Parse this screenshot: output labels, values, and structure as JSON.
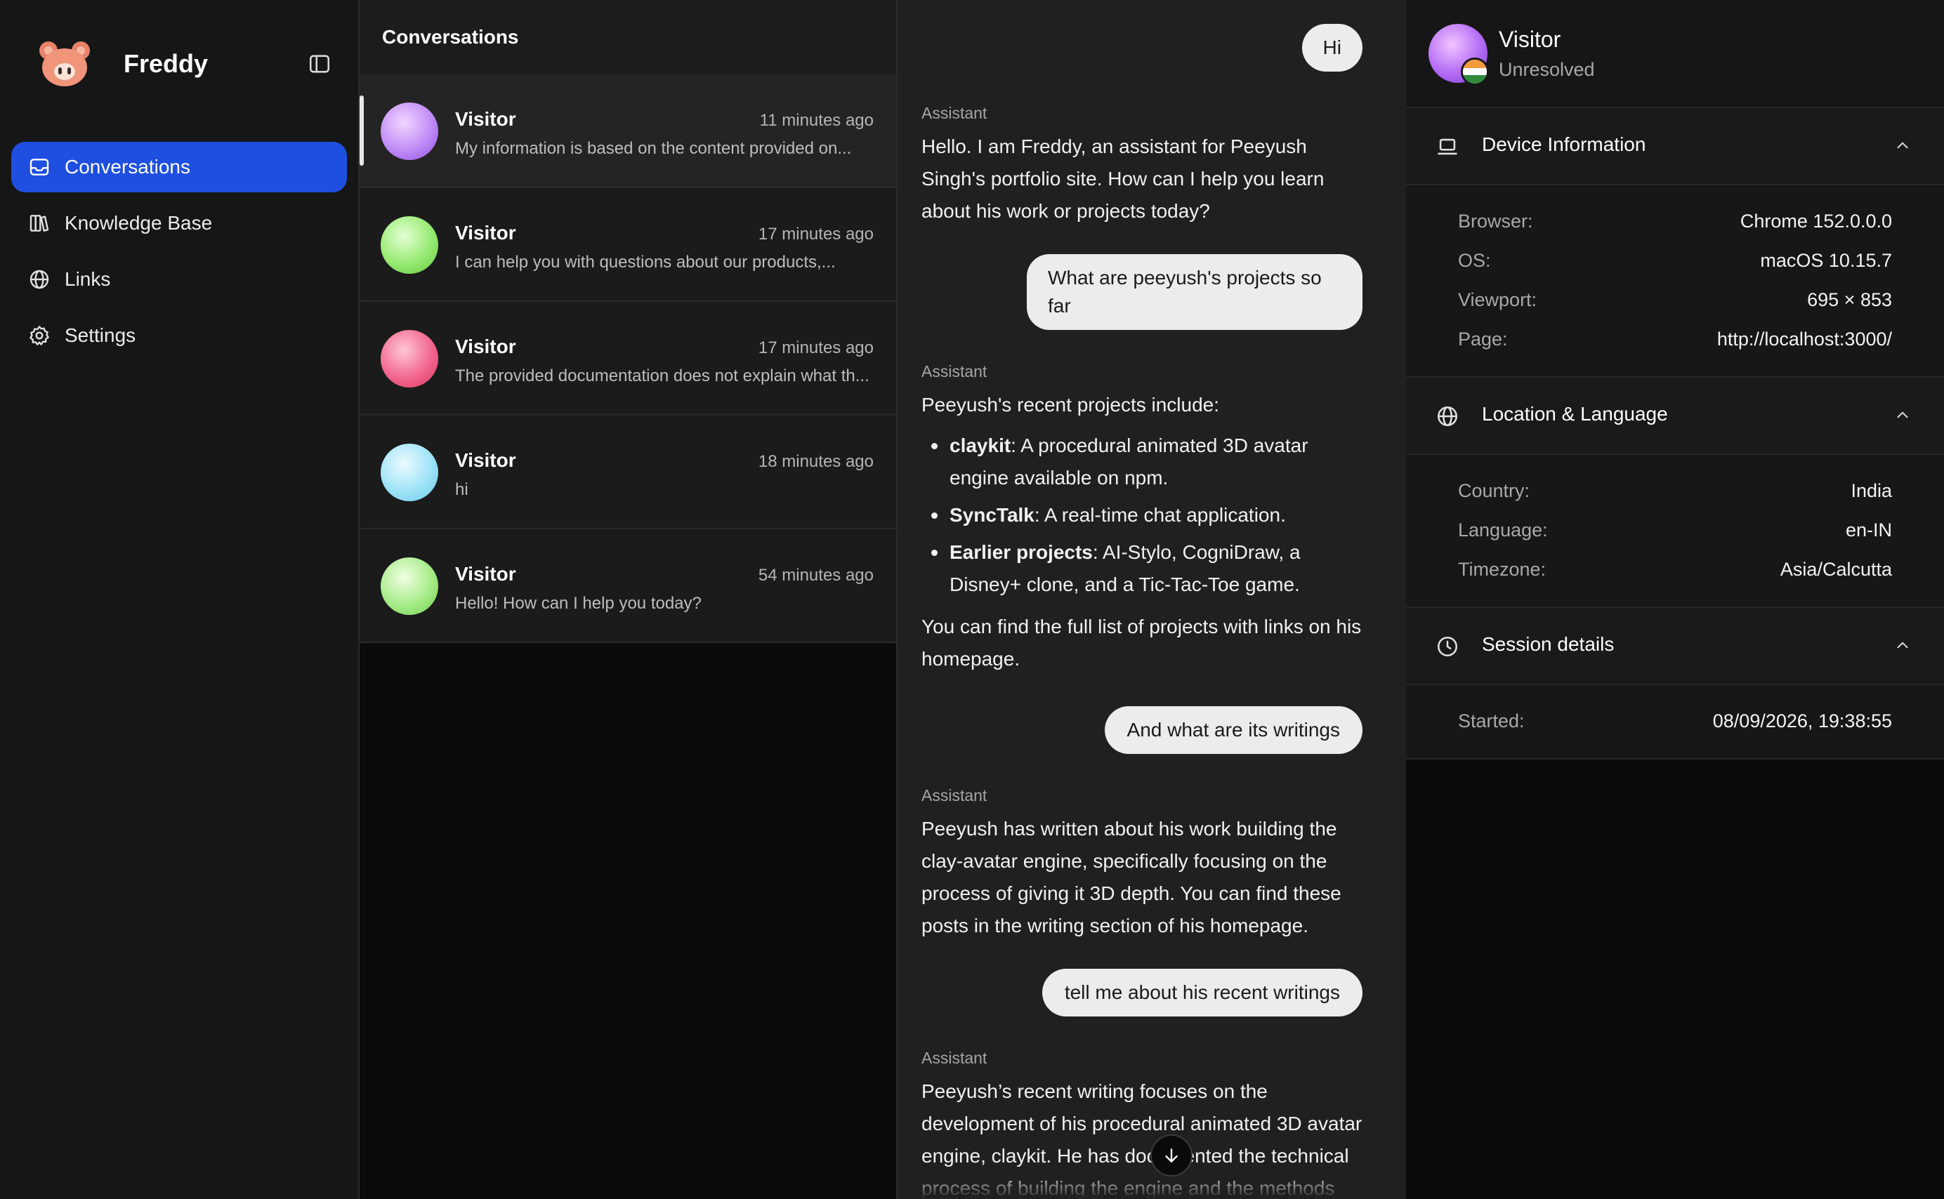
{
  "sidebar": {
    "brand": "Freddy",
    "items": [
      {
        "label": "Conversations",
        "icon": "inbox-icon",
        "active": true
      },
      {
        "label": "Knowledge Base",
        "icon": "books-icon",
        "active": false
      },
      {
        "label": "Links",
        "icon": "globe-icon",
        "active": false
      },
      {
        "label": "Settings",
        "icon": "gear-icon",
        "active": false
      }
    ]
  },
  "conversations": {
    "title": "Conversations",
    "items": [
      {
        "name": "Visitor",
        "time": "11 minutes ago",
        "preview": "My information is based on the content provided on...",
        "avatar_color": "#c08cf6",
        "selected": true
      },
      {
        "name": "Visitor",
        "time": "17 minutes ago",
        "preview": "I can help you with questions about our products,...",
        "avatar_color": "#97ea72",
        "selected": false
      },
      {
        "name": "Visitor",
        "time": "17 minutes ago",
        "preview": "The provided documentation does not explain what th...",
        "avatar_color": "#f2678f",
        "selected": false
      },
      {
        "name": "Visitor",
        "time": "18 minutes ago",
        "preview": "hi",
        "avatar_color": "#9ee3f7",
        "selected": false
      },
      {
        "name": "Visitor",
        "time": "54 minutes ago",
        "preview": "Hello! How can I help you today?",
        "avatar_color": "#a6ec88",
        "selected": false
      }
    ]
  },
  "chat": {
    "assistant_label": "Assistant",
    "msg_user_1": "Hi",
    "msg_asst_1": "Hello. I am Freddy, an assistant for Peeyush Singh's portfolio site. How can I help you learn about his work or projects today?",
    "msg_user_2": "What are peeyush's projects so far",
    "msg_asst_2": {
      "intro": "Peeyush's recent projects include:",
      "bullets": [
        {
          "bold": "claykit",
          "text": ": A procedural animated 3D avatar engine available on npm."
        },
        {
          "bold": "SyncTalk",
          "text": ": A real-time chat application."
        },
        {
          "bold": "Earlier projects",
          "text": ": AI-Stylo, CogniDraw, a Disney+ clone, and a Tic-Tac-Toe game."
        }
      ],
      "outro": "You can find the full list of projects with links on his homepage."
    },
    "msg_user_3": "And what are its writings",
    "msg_asst_3": "Peeyush has written about his work building the clay-avatar engine, specifically focusing on the process of giving it 3D depth. You can find these posts in the writing section of his homepage.",
    "msg_user_4": "tell me about his recent writings",
    "msg_asst_4": "Peeyush’s recent writing focuses on the development of his procedural animated 3D avatar engine, claykit. He has documented the technical process of building the engine and the methods"
  },
  "details": {
    "visitor_name": "Visitor",
    "visitor_status": "Unresolved",
    "device": {
      "title": "Device Information",
      "rows": [
        {
          "key": "Browser:",
          "value": "Chrome 152.0.0.0"
        },
        {
          "key": "OS:",
          "value": "macOS 10.15.7"
        },
        {
          "key": "Viewport:",
          "value": "695 × 853"
        },
        {
          "key": "Page:",
          "value": "http://localhost:3000/"
        }
      ]
    },
    "location": {
      "title": "Location & Language",
      "rows": [
        {
          "key": "Country:",
          "value": "India"
        },
        {
          "key": "Language:",
          "value": "en-IN"
        },
        {
          "key": "Timezone:",
          "value": "Asia/Calcutta"
        }
      ]
    },
    "session": {
      "title": "Session details",
      "rows": [
        {
          "key": "Started:",
          "value": "08/09/2026, 19:38:55"
        }
      ]
    }
  }
}
